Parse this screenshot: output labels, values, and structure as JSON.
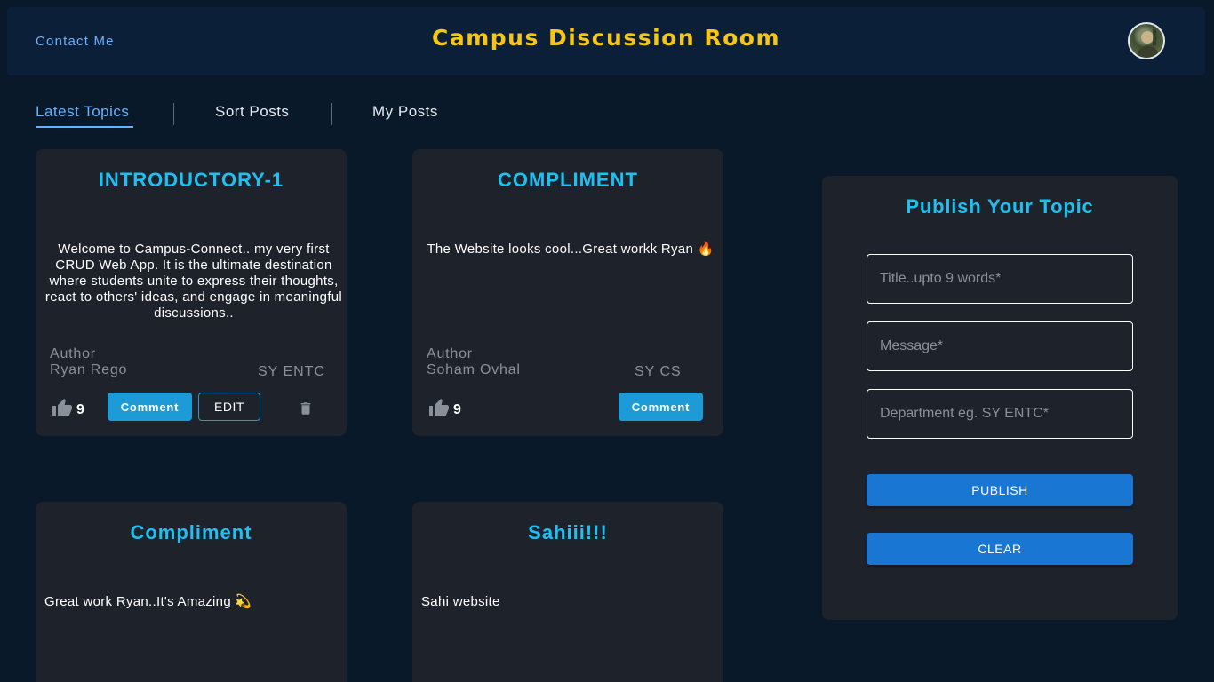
{
  "header": {
    "contact_label": "Contact Me",
    "title": "Campus Discussion Room",
    "avatar": "user-avatar"
  },
  "tabs": [
    {
      "label": "Latest Topics",
      "active": true
    },
    {
      "label": "Sort Posts",
      "active": false
    },
    {
      "label": "My Posts",
      "active": false
    }
  ],
  "posts": [
    {
      "title": "INTRODUCTORY-1",
      "message": "Welcome to Campus-Connect.. my very first CRUD Web App. It is the ultimate destination where students unite to express their thoughts, react to others' ideas, and engage in meaningful discussions..",
      "author_label": "Author",
      "author": "Ryan Rego",
      "department": "SY ENTC",
      "likes": "9",
      "comment_label": "Comment",
      "edit_label": "EDIT"
    },
    {
      "title": "COMPLIMENT",
      "message": "The Website looks cool...Great workk Ryan 🔥",
      "author_label": "Author",
      "author": "Soham Ovhal",
      "department": "SY CS",
      "likes": "9",
      "comment_label": "Comment"
    },
    {
      "title": "Compliment",
      "message": "Great work Ryan..It's Amazing 💫"
    },
    {
      "title": "Sahiii!!!",
      "message": "Sahi website"
    }
  ],
  "publish": {
    "title": "Publish Your Topic",
    "title_placeholder": "Title..upto 9 words*",
    "message_placeholder": "Message*",
    "department_placeholder": "Department eg. SY ENTC*",
    "publish_label": "PUBLISH",
    "clear_label": "CLEAR"
  },
  "colors": {
    "background": "#0a1929",
    "accent": "#1ec0f2",
    "title_yellow": "#f5c518",
    "button_blue": "#1976d2"
  },
  "icons": [
    "thumbs-up-icon",
    "trash-icon"
  ]
}
